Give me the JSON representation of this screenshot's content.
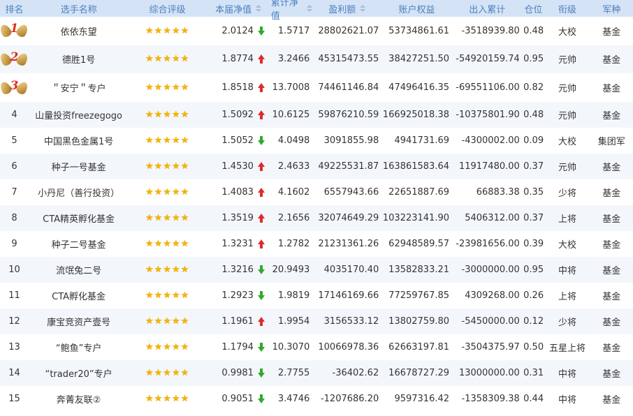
{
  "headers": {
    "rank": "排名",
    "name": "选手名称",
    "rating": "综合评级",
    "nav": "本届净值",
    "cum_nav": "累计净值",
    "profit": "盈利额",
    "equity": "账户权益",
    "flow": "出入累计",
    "position": "仓位",
    "rank_title": "衔级",
    "type": "军种"
  },
  "icons": {
    "medal": "laurel-medal-icon",
    "star": "star-icon",
    "up": "red-up-arrow-icon",
    "down": "green-down-arrow-icon",
    "sort": "sort-icon"
  },
  "colors": {
    "header_bg": "#d4e4f6",
    "header_text": "#4f7fbf",
    "up": "#e02a2a",
    "down": "#2faa2f",
    "star": "#f5b301",
    "medal_num": "#e0301e",
    "alt_row": "#f3f7fc"
  },
  "rows": [
    {
      "rank": "1",
      "name": "依依东望",
      "stars": 5,
      "nav": "2.0124",
      "dir": "down",
      "cum_nav": "1.5717",
      "profit": "28802621.07",
      "equity": "53734861.61",
      "flow": "-3518939.80",
      "position": "0.48",
      "rank_title": "大校",
      "type": "基金"
    },
    {
      "rank": "2",
      "name": "德胜1号",
      "stars": 5,
      "nav": "1.8774",
      "dir": "up",
      "cum_nav": "3.2466",
      "profit": "45315473.55",
      "equity": "38427251.50",
      "flow": "-54920159.74",
      "position": "0.95",
      "rank_title": "元帅",
      "type": "基金"
    },
    {
      "rank": "3",
      "name": "＂安宁＂专户",
      "stars": 5,
      "nav": "1.8518",
      "dir": "up",
      "cum_nav": "13.7008",
      "profit": "74461146.84",
      "equity": "47496416.35",
      "flow": "-69551106.00",
      "position": "0.82",
      "rank_title": "元帅",
      "type": "基金"
    },
    {
      "rank": "4",
      "name": "山量投资freezegogo",
      "stars": 5,
      "nav": "1.5092",
      "dir": "up",
      "cum_nav": "10.6125",
      "profit": "59876210.59",
      "equity": "166925018.38",
      "flow": "-10375801.90",
      "position": "0.48",
      "rank_title": "元帅",
      "type": "基金"
    },
    {
      "rank": "5",
      "name": "中国黑色金属1号",
      "stars": 5,
      "nav": "1.5052",
      "dir": "down",
      "cum_nav": "4.0498",
      "profit": "3091855.98",
      "equity": "4941731.69",
      "flow": "-4300002.00",
      "position": "0.09",
      "rank_title": "大校",
      "type": "集团军"
    },
    {
      "rank": "6",
      "name": "种子一号基金",
      "stars": 5,
      "nav": "1.4530",
      "dir": "up",
      "cum_nav": "2.4633",
      "profit": "49225531.87",
      "equity": "163861583.64",
      "flow": "11917480.00",
      "position": "0.37",
      "rank_title": "元帅",
      "type": "基金"
    },
    {
      "rank": "7",
      "name": "小丹尼（善行投资）",
      "stars": 5,
      "nav": "1.4083",
      "dir": "up",
      "cum_nav": "4.1602",
      "profit": "6557943.66",
      "equity": "22651887.69",
      "flow": "66883.38",
      "position": "0.35",
      "rank_title": "少将",
      "type": "基金"
    },
    {
      "rank": "8",
      "name": "CTA精英孵化基金",
      "stars": 5,
      "nav": "1.3519",
      "dir": "up",
      "cum_nav": "2.1656",
      "profit": "32074649.29",
      "equity": "103223141.90",
      "flow": "5406312.00",
      "position": "0.37",
      "rank_title": "上将",
      "type": "基金"
    },
    {
      "rank": "9",
      "name": "种子二号基金",
      "stars": 5,
      "nav": "1.3231",
      "dir": "up",
      "cum_nav": "1.2782",
      "profit": "21231361.26",
      "equity": "62948589.57",
      "flow": "-23981656.00",
      "position": "0.39",
      "rank_title": "大校",
      "type": "基金"
    },
    {
      "rank": "10",
      "name": "流氓兔二号",
      "stars": 5,
      "nav": "1.3216",
      "dir": "down",
      "cum_nav": "20.9493",
      "profit": "4035170.40",
      "equity": "13582833.21",
      "flow": "-3000000.00",
      "position": "0.95",
      "rank_title": "中将",
      "type": "基金"
    },
    {
      "rank": "11",
      "name": "CTA孵化基金",
      "stars": 5,
      "nav": "1.2923",
      "dir": "down",
      "cum_nav": "1.9819",
      "profit": "17146169.66",
      "equity": "77259767.85",
      "flow": "4309268.00",
      "position": "0.26",
      "rank_title": "上将",
      "type": "基金"
    },
    {
      "rank": "12",
      "name": "康宝竞资产壹号",
      "stars": 5,
      "nav": "1.1961",
      "dir": "up",
      "cum_nav": "1.9954",
      "profit": "3156533.12",
      "equity": "13802759.80",
      "flow": "-5450000.00",
      "position": "0.12",
      "rank_title": "少将",
      "type": "基金"
    },
    {
      "rank": "13",
      "name": "“鲍鱼”专户",
      "stars": 5,
      "nav": "1.1794",
      "dir": "down",
      "cum_nav": "10.3070",
      "profit": "10066978.36",
      "equity": "62663197.81",
      "flow": "-3504375.97",
      "position": "0.50",
      "rank_title": "五星上将",
      "type": "基金"
    },
    {
      "rank": "14",
      "name": "“trader20”专户",
      "stars": 5,
      "nav": "0.9981",
      "dir": "down",
      "cum_nav": "2.7755",
      "profit": "-36402.62",
      "equity": "16678727.29",
      "flow": "13000000.00",
      "position": "0.31",
      "rank_title": "中将",
      "type": "基金"
    },
    {
      "rank": "15",
      "name": "奔菁友联②",
      "stars": 5,
      "nav": "0.9051",
      "dir": "down",
      "cum_nav": "3.4746",
      "profit": "-1207686.20",
      "equity": "9597316.42",
      "flow": "-1358309.38",
      "position": "0.44",
      "rank_title": "中将",
      "type": "基金"
    }
  ]
}
